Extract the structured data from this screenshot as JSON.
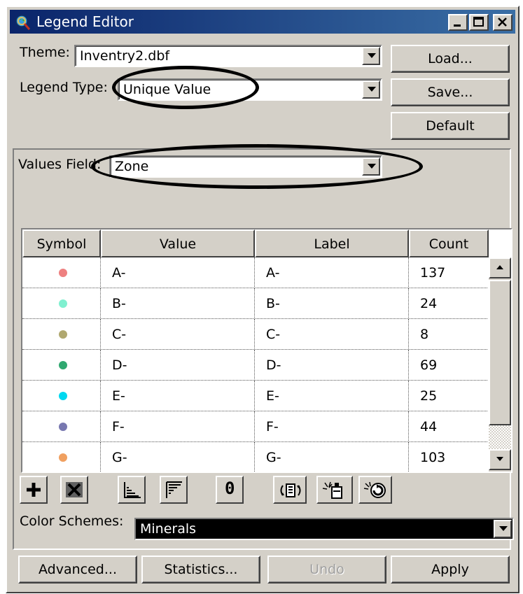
{
  "window": {
    "title": "Legend Editor",
    "icon": "globe-magnifier-icon"
  },
  "theme": {
    "label": "Theme:",
    "value": "Inventry2.dbf"
  },
  "legend_type": {
    "label": "Legend Type:",
    "value": "Unique Value"
  },
  "values_field": {
    "label": "Values Field:",
    "value": "Zone"
  },
  "buttons": {
    "load": "Load...",
    "save": "Save...",
    "default": "Default",
    "advanced": "Advanced...",
    "statistics": "Statistics...",
    "undo": "Undo",
    "apply": "Apply"
  },
  "table": {
    "columns": [
      "Symbol",
      "Value",
      "Label",
      "Count"
    ],
    "rows": [
      {
        "color": "#ee8080",
        "value": "A-",
        "label": "A-",
        "count": "137"
      },
      {
        "color": "#80f0d0",
        "value": "B-",
        "label": "B-",
        "count": "24"
      },
      {
        "color": "#b0a870",
        "value": "C-",
        "label": "C-",
        "count": "8"
      },
      {
        "color": "#30a870",
        "value": "D-",
        "label": "D-",
        "count": "69"
      },
      {
        "color": "#00d8f0",
        "value": "E-",
        "label": "E-",
        "count": "25"
      },
      {
        "color": "#7878b0",
        "value": "F-",
        "label": "F-",
        "count": "44"
      },
      {
        "color": "#f0a060",
        "value": "G-",
        "label": "G-",
        "count": "103"
      }
    ]
  },
  "toolbar": {
    "icons": [
      "add-icon",
      "delete-icon",
      "sort-ascending-icon",
      "sort-descending-icon",
      "null-value-icon",
      "flip-symbols-icon",
      "random-color-icon",
      "reset-icon"
    ],
    "null_glyph": "0"
  },
  "color_schemes": {
    "label": "Color Schemes:",
    "value": "Minerals"
  }
}
